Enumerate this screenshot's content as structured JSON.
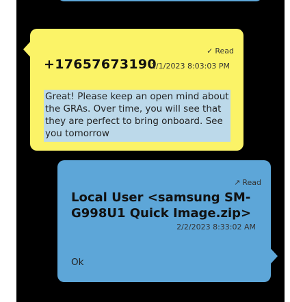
{
  "colors": {
    "background": "#000000",
    "incoming_bubble": "#fbf367",
    "outgoing_bubble": "#5da6d8",
    "text_highlight": "#bcd9ea"
  },
  "messages": [
    {
      "direction": "incoming",
      "status_icon": "check-icon",
      "status_glyph": "✓",
      "status": "Read",
      "sender": "+17657673190",
      "timestamp": "2/1/2023 8:03:03 PM",
      "body": "Great! Please keep an open mind about the GRAs. Over time, you will see that they are perfect to bring onboard. See you tomorrow"
    },
    {
      "direction": "outgoing",
      "status_icon": "arrow-up-right-icon",
      "status_glyph": "↗",
      "status": "Read",
      "sender": "Local User <samsung SM-G998U1 Quick Image.zip>",
      "timestamp": "2/2/2023 8:33:02 AM",
      "body": "Ok"
    }
  ]
}
